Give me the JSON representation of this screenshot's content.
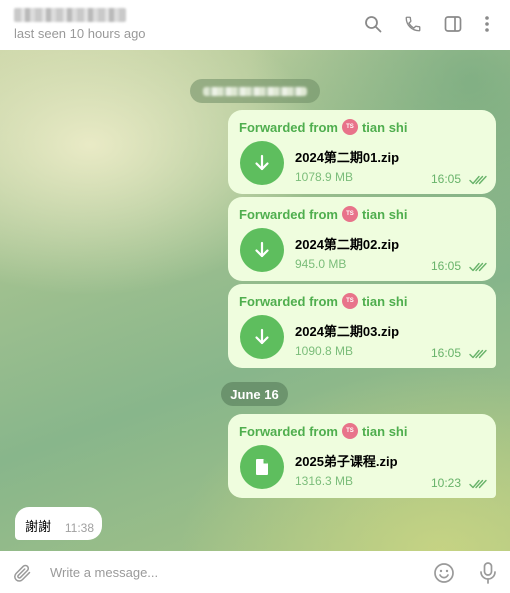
{
  "header": {
    "status": "last seen 10 hours ago",
    "icons": [
      "search-icon",
      "phone-icon",
      "sidebar-toggle-icon",
      "more-vertical-icon"
    ]
  },
  "messages": [
    {
      "forwarded_label": "Forwarded from",
      "sender": "tian shi",
      "avatar_initials": "TS",
      "file_name": "2024第二期01.zip",
      "file_size": "1078.9 MB",
      "time": "16:05",
      "icon": "download-icon"
    },
    {
      "forwarded_label": "Forwarded from",
      "sender": "tian shi",
      "avatar_initials": "TS",
      "file_name": "2024第二期02.zip",
      "file_size": "945.0 MB",
      "time": "16:05",
      "icon": "download-icon"
    },
    {
      "forwarded_label": "Forwarded from",
      "sender": "tian shi",
      "avatar_initials": "TS",
      "file_name": "2024第二期03.zip",
      "file_size": "1090.8 MB",
      "time": "16:05",
      "icon": "download-icon"
    },
    {
      "forwarded_label": "Forwarded from",
      "sender": "tian shi",
      "avatar_initials": "TS",
      "file_name": "2025弟子课程.zip",
      "file_size": "1316.3 MB",
      "time": "10:23",
      "icon": "file-icon"
    }
  ],
  "date_separator": "June 16",
  "incoming": {
    "text": "謝謝",
    "time": "11:38"
  },
  "composer": {
    "placeholder": "Write a message..."
  },
  "colors": {
    "accent": "#4fae4e",
    "bubble_out": "#effdde",
    "file_circle": "#5ebe5e"
  }
}
